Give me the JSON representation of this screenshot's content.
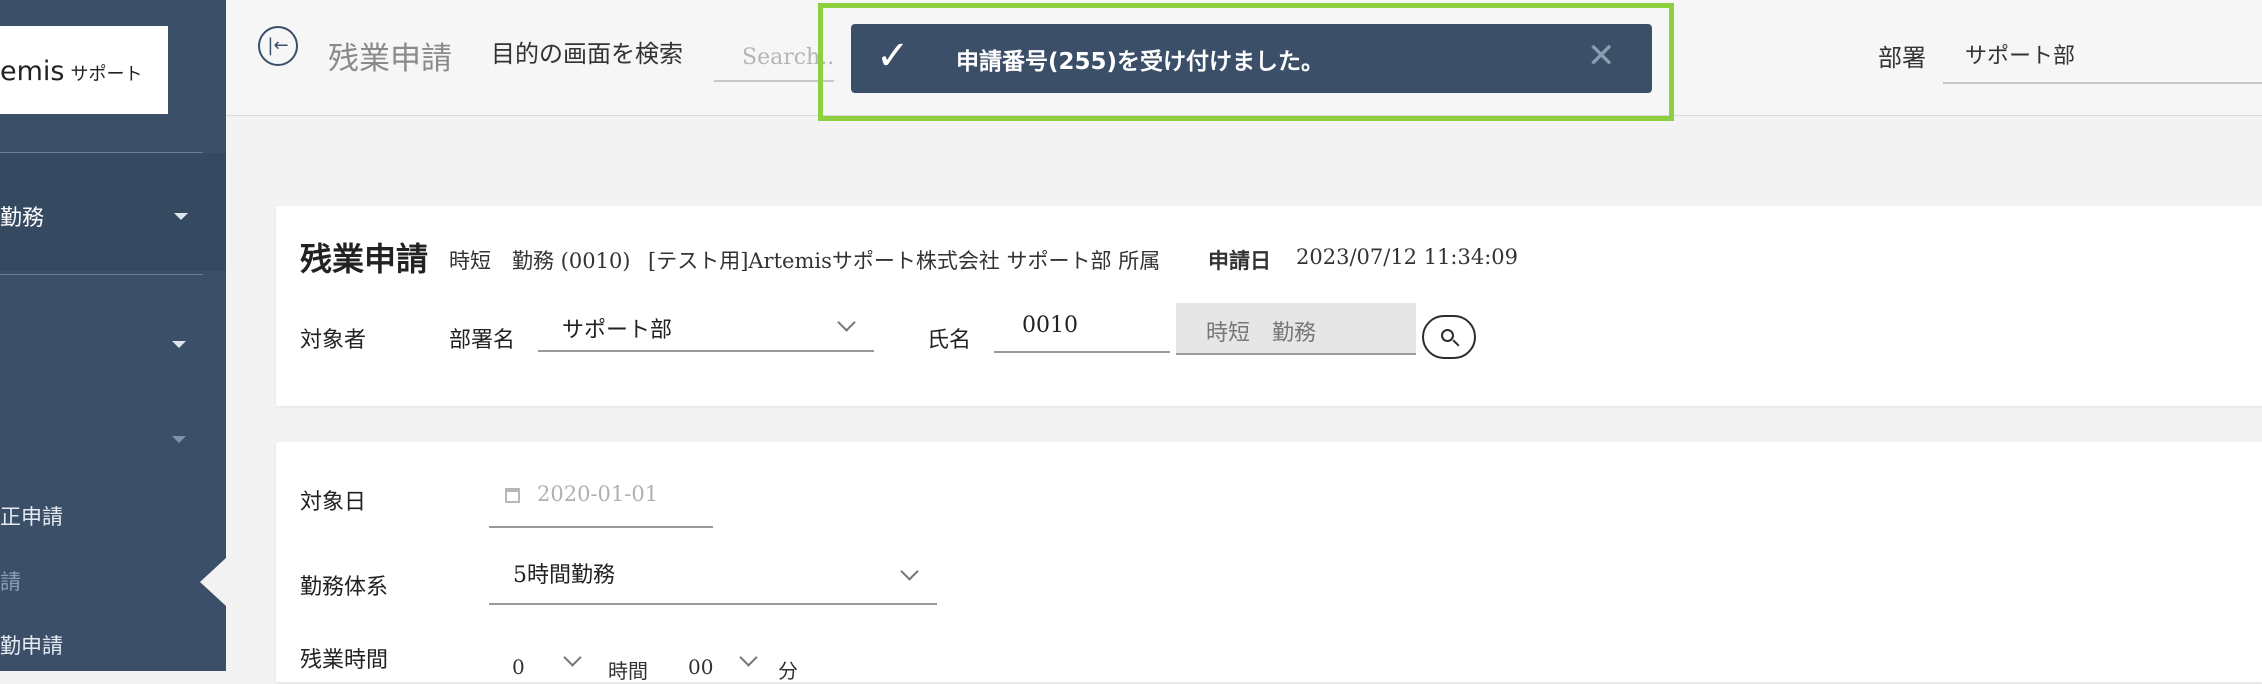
{
  "sidebar": {
    "logo_text": "emis",
    "logo_sub": "サポート",
    "group_label": "勤務",
    "links": [
      "正申請",
      "請",
      "勤申請"
    ]
  },
  "topbar": {
    "page_title": "残業申請",
    "search_label": "目的の画面を検索",
    "search_placeholder": "Search...",
    "dept_label": "部署",
    "dept_value": "サポート部"
  },
  "toast": {
    "message": "申請番号(255)を受け付けました。",
    "check_glyph": "✓",
    "close_glyph": "✕"
  },
  "header_card": {
    "title": "残業申請",
    "user_info": "時短　勤務 (0010)",
    "company": "[テスト用]Artemisサポート株式会社 サポート部 所属",
    "applied_label": "申請日",
    "applied_value": "2023/07/12 11:34:09",
    "target_label": "対象者",
    "dept_field_label": "部署名",
    "dept_field_value": "サポート部",
    "name_label": "氏名",
    "name_code": "0010",
    "name_value": "時短　勤務"
  },
  "form_card": {
    "date_label": "対象日",
    "date_placeholder": "2020-01-01",
    "system_label": "勤務体系",
    "system_value": "5時間勤務",
    "overtime_label": "残業時間",
    "hours_value": "0",
    "hours_unit": "時間",
    "minutes_value": "00",
    "minutes_unit": "分"
  },
  "colors": {
    "sidebar": "#3b4f69",
    "toast": "#3b4f69",
    "highlight": "#8ecf3f"
  }
}
